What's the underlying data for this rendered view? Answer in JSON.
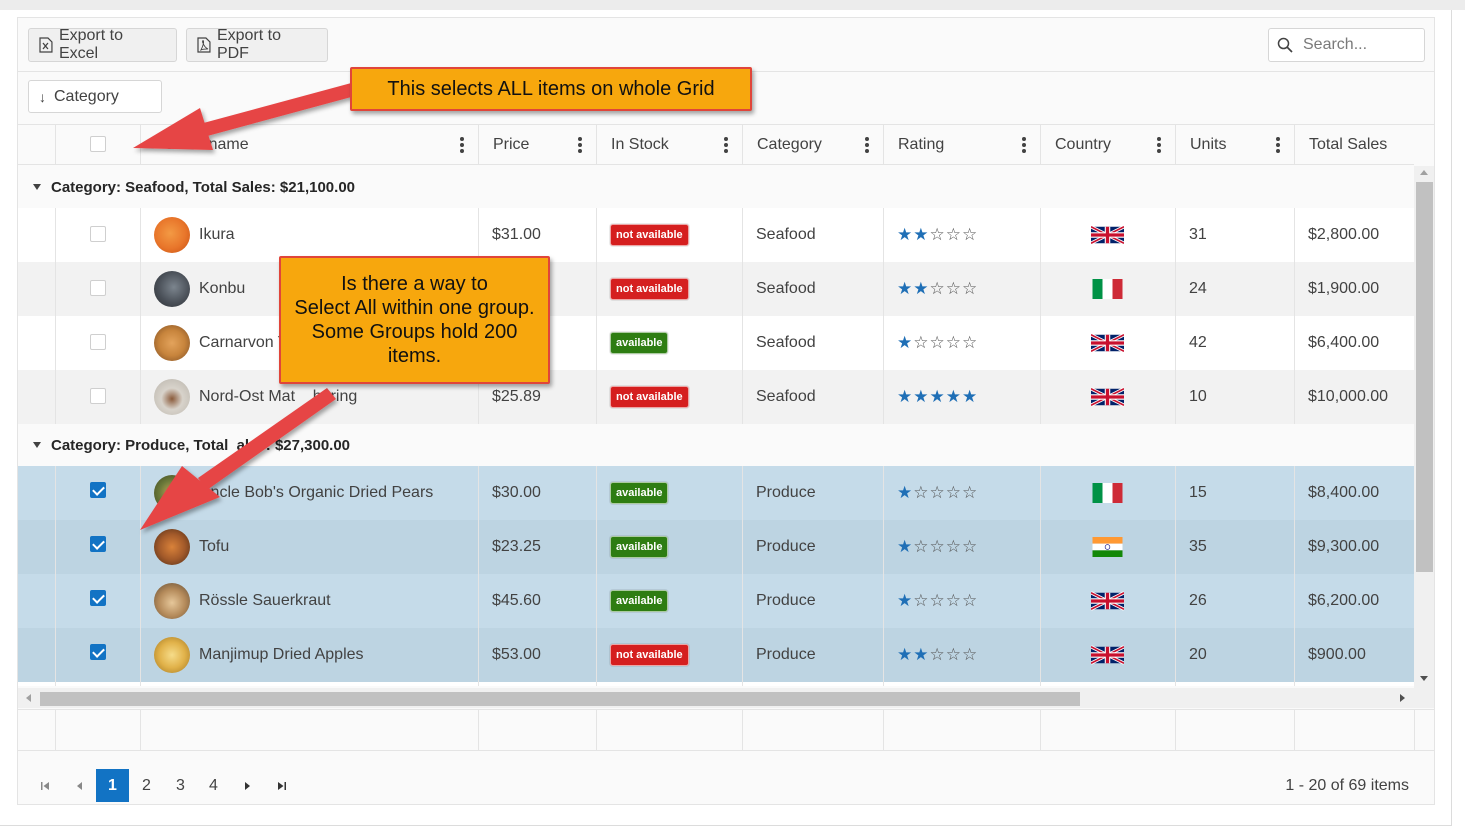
{
  "toolbar": {
    "export_excel_label": "Export to Excel",
    "export_pdf_label": "Export to PDF",
    "search_placeholder": "Search..."
  },
  "grouping": {
    "chip_label": "Category"
  },
  "columns": {
    "product_name": "oduct name",
    "price": "Price",
    "in_stock": "In Stock",
    "category": "Category",
    "rating": "Rating",
    "country": "Country",
    "units": "Units",
    "total_sales": "Total Sales"
  },
  "groups": [
    {
      "header": "Category: Seafood, Total Sales: $21,100.00",
      "rows": [
        {
          "name": "Ikura",
          "price": "$31.00",
          "stock": "not available",
          "category": "Seafood",
          "rating": 2,
          "country": "uk",
          "units": "31",
          "sales": "$2,800.00",
          "selected": false,
          "avatar_color": "#e8752a"
        },
        {
          "name": "Konbu",
          "price": "",
          "stock": "not available",
          "category": "Seafood",
          "rating": 2,
          "country": "it",
          "units": "24",
          "sales": "$1,900.00",
          "selected": false,
          "avatar_color": "#4a5058"
        },
        {
          "name": "Carnarvon T",
          "price": "",
          "stock": "available",
          "category": "Seafood",
          "rating": 1,
          "country": "uk",
          "units": "42",
          "sales": "$6,400.00",
          "selected": false,
          "avatar_color": "#c7843c"
        },
        {
          "name": "Nord-Ost Mat    hering",
          "price": "$25.89",
          "stock": "not available",
          "category": "Seafood",
          "rating": 5,
          "country": "uk",
          "units": "10",
          "sales": "$10,000.00",
          "selected": false,
          "avatar_color": "#b9b4ab"
        }
      ]
    },
    {
      "header": "Category: Produce, Total  ales: $27,300.00",
      "rows": [
        {
          "name": "Uncle Bob's Organic Dried Pears",
          "price": "$30.00",
          "stock": "available",
          "category": "Produce",
          "rating": 1,
          "country": "it",
          "units": "15",
          "sales": "$8,400.00",
          "selected": true,
          "avatar_color": "#6b7a3a"
        },
        {
          "name": "Tofu",
          "price": "$23.25",
          "stock": "available",
          "category": "Produce",
          "rating": 1,
          "country": "in",
          "units": "35",
          "sales": "$9,300.00",
          "selected": true,
          "avatar_color": "#a35a2a"
        },
        {
          "name": "Rössle Sauerkraut",
          "price": "$45.60",
          "stock": "available",
          "category": "Produce",
          "rating": 1,
          "country": "uk",
          "units": "26",
          "sales": "$6,200.00",
          "selected": true,
          "avatar_color": "#b48a5a"
        },
        {
          "name": "Manjimup Dried Apples",
          "price": "$53.00",
          "stock": "not available",
          "category": "Produce",
          "rating": 2,
          "country": "uk",
          "units": "20",
          "sales": "$900.00",
          "selected": true,
          "avatar_color": "#e1b24a"
        }
      ]
    }
  ],
  "pager": {
    "pages": [
      "1",
      "2",
      "3",
      "4"
    ],
    "active": "1",
    "info": "1 - 20 of 69 items"
  },
  "callouts": {
    "top": "This selects ALL items on whole Grid",
    "middle_lines": [
      "Is there a way to",
      "Select All within one group.",
      "Some Groups hold 200",
      "items."
    ]
  },
  "colors": {
    "accent": "#1273c4",
    "available": "#2e7d12",
    "not_available": "#d51f1f",
    "selected_row": "#c5dbe9",
    "callout": "#f7a70d",
    "arrow": "#e64545",
    "star": "#1f6fb6"
  },
  "icons": {
    "excel": "excel-file-icon",
    "pdf": "pdf-file-icon",
    "search": "search-icon",
    "sort": "sort-arrow-down-icon",
    "menu": "column-menu-icon",
    "collapse": "caret-down-icon",
    "pager_first": "first-page-icon",
    "pager_prev": "previous-page-icon",
    "pager_next": "next-page-icon",
    "pager_last": "last-page-icon"
  }
}
